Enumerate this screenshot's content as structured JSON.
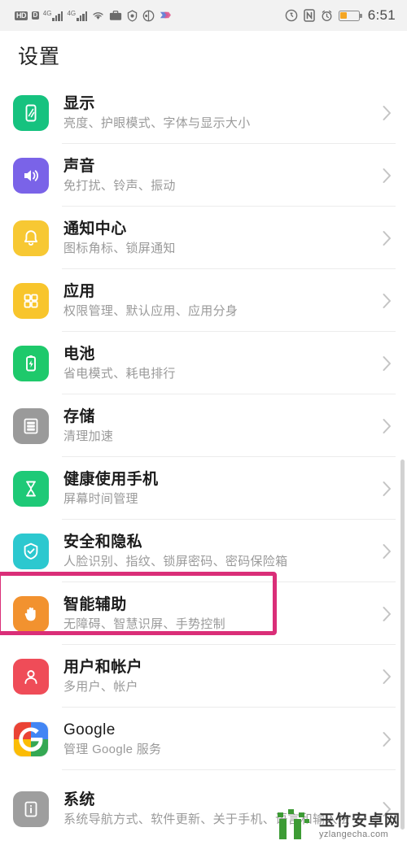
{
  "status_bar": {
    "hd_label": "HD",
    "volte_label": "D",
    "network_label_1": "4G",
    "network_label_2": "4G",
    "left_icons": [
      "hd-icon",
      "volte-icon",
      "signal-4g-icon",
      "signal-4g-icon-2",
      "wifi-icon",
      "briefcase-icon",
      "shield-icon",
      "sync-circle-icon",
      "send-icon"
    ],
    "right_icons": [
      "data-saver-icon",
      "nfc-icon",
      "alarm-icon",
      "battery-icon"
    ],
    "battery_level_percent": 38,
    "battery_color": "#f5a623",
    "time": "6:51"
  },
  "header": {
    "title": "设置"
  },
  "settings_list": [
    {
      "id": "display",
      "title": "显示",
      "subtitle": "亮度、护眼模式、字体与显示大小",
      "icon_name": "display-icon",
      "icon_color": "#16c27f"
    },
    {
      "id": "sound",
      "title": "声音",
      "subtitle": "免打扰、铃声、振动",
      "icon_name": "sound-icon",
      "icon_color": "#7a63e8"
    },
    {
      "id": "notification-center",
      "title": "通知中心",
      "subtitle": "图标角标、锁屏通知",
      "icon_name": "bell-icon",
      "icon_color": "#f7c833"
    },
    {
      "id": "apps",
      "title": "应用",
      "subtitle": "权限管理、默认应用、应用分身",
      "icon_name": "apps-grid-icon",
      "icon_color": "#f8c52c"
    },
    {
      "id": "battery",
      "title": "电池",
      "subtitle": "省电模式、耗电排行",
      "icon_name": "battery-icon",
      "icon_color": "#1ec96b"
    },
    {
      "id": "storage",
      "title": "存储",
      "subtitle": "清理加速",
      "icon_name": "storage-icon",
      "icon_color": "#9a9a9a"
    },
    {
      "id": "digital-wellbeing",
      "title": "健康使用手机",
      "subtitle": "屏幕时间管理",
      "icon_name": "hourglass-icon",
      "icon_color": "#1ec977"
    },
    {
      "id": "security-privacy",
      "title": "安全和隐私",
      "subtitle": "人脸识别、指纹、锁屏密码、密码保险箱",
      "icon_name": "shield-check-icon",
      "icon_color": "#2cc8cf"
    },
    {
      "id": "smart-assistance",
      "title": "智能辅助",
      "subtitle": "无障碍、智慧识屏、手势控制",
      "icon_name": "hand-icon",
      "icon_color": "#f2922f",
      "highlighted": true
    },
    {
      "id": "users-accounts",
      "title": "用户和帐户",
      "subtitle": "多用户、帐户",
      "icon_name": "user-icon",
      "icon_color": "#ef4c58"
    },
    {
      "id": "google",
      "title": "Google",
      "subtitle": "管理 Google 服务",
      "icon_name": "google-icon",
      "icon_color": "#ffffff"
    },
    {
      "id": "system",
      "title": "系统",
      "subtitle": "系统导航方式、软件更新、关于手机、语言和输入法",
      "icon_name": "info-icon",
      "icon_color": "#9e9e9e"
    }
  ],
  "highlight": {
    "color": "#da2e78"
  },
  "chevron_glyph": "›",
  "watermark": {
    "cn": "玉竹安卓网",
    "en": "yzlangecha.com"
  }
}
